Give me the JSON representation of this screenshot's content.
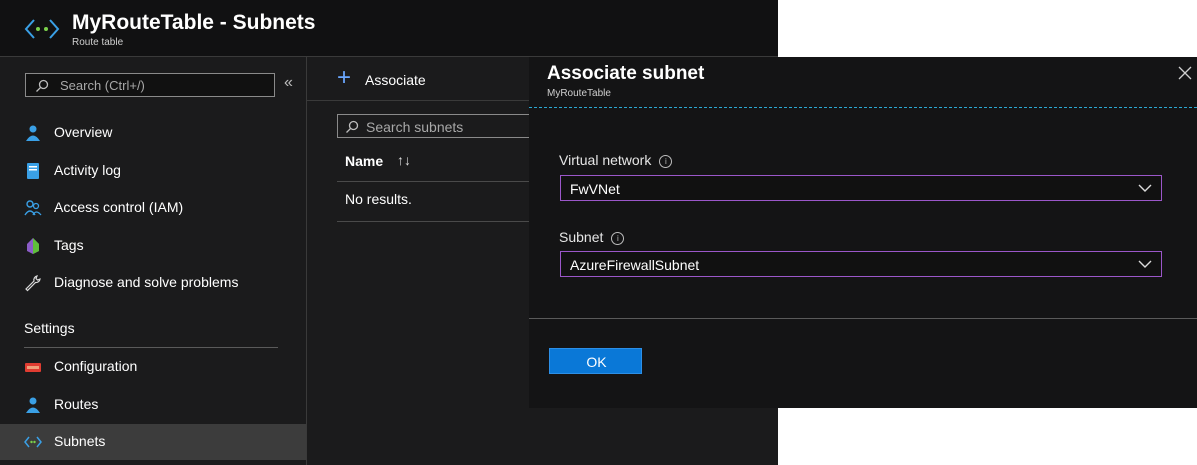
{
  "header": {
    "title": "MyRouteTable - Subnets",
    "subtitle": "Route table"
  },
  "sidebar": {
    "search_placeholder": "Search (Ctrl+/)",
    "collapse_glyph": "«",
    "items": [
      {
        "label": "Overview",
        "icon": "overview-icon"
      },
      {
        "label": "Activity log",
        "icon": "activity-log-icon"
      },
      {
        "label": "Access control (IAM)",
        "icon": "iam-icon"
      },
      {
        "label": "Tags",
        "icon": "tag-icon"
      },
      {
        "label": "Diagnose and solve problems",
        "icon": "wrench-icon"
      }
    ],
    "settings_heading": "Settings",
    "settings_items": [
      {
        "label": "Configuration",
        "icon": "configuration-icon"
      },
      {
        "label": "Routes",
        "icon": "routes-icon"
      },
      {
        "label": "Subnets",
        "icon": "subnets-icon",
        "active": true
      }
    ]
  },
  "content": {
    "associate_label": "Associate",
    "search_placeholder": "Search subnets",
    "column_name": "Name",
    "sort_glyph": "↑↓",
    "empty_text": "No results."
  },
  "dialog": {
    "title": "Associate subnet",
    "subtitle": "MyRouteTable",
    "vnet_label": "Virtual network",
    "vnet_value": "FwVNet",
    "subnet_label": "Subnet",
    "subnet_value": "AzureFirewallSubnet",
    "ok_label": "OK"
  },
  "colors": {
    "accent": "#0a78d7",
    "select_border": "#9b57c9",
    "dashed_line": "#2aa7d1",
    "background": "#1b1b1c"
  }
}
